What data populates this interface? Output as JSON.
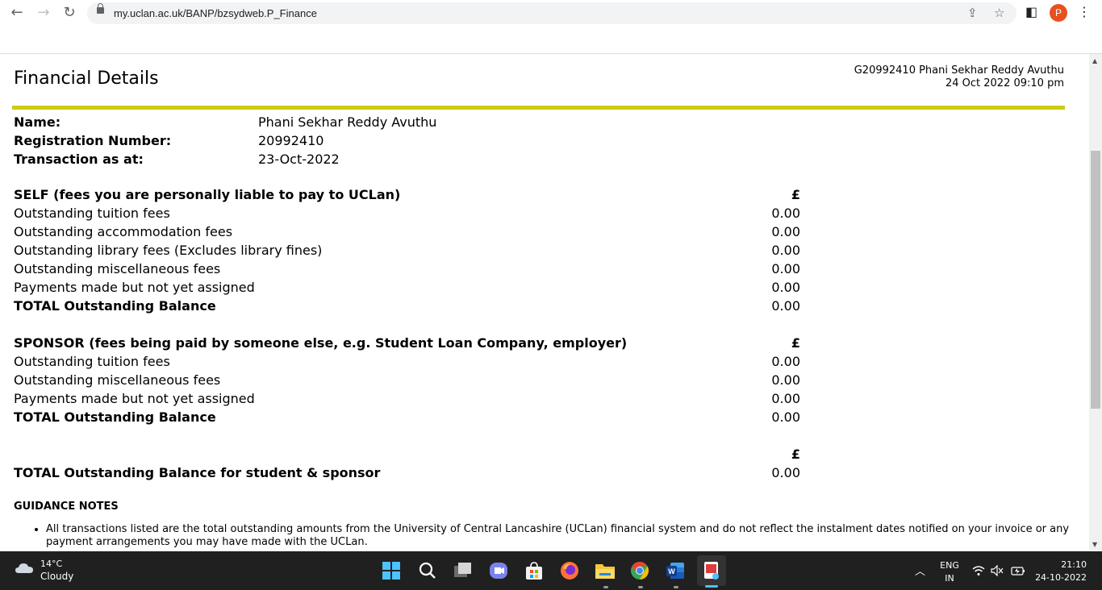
{
  "browser": {
    "url": "my.uclan.ac.uk/BANP/bzsydweb.P_Finance",
    "profile_initial": "P"
  },
  "header": {
    "title": "Financial Details",
    "user_line": "G20992410 Phani Sekhar Reddy Avuthu",
    "datetime_line": "24 Oct 2022 09:10 pm"
  },
  "student": {
    "name_label": "Name:",
    "name_value": "Phani Sekhar Reddy Avuthu",
    "reg_label": "Registration Number:",
    "reg_value": "20992410",
    "date_label": "Transaction as at:",
    "date_value": "23-Oct-2022"
  },
  "self": {
    "heading": "SELF (fees you are personally liable to pay to UCLan)",
    "currency": "£",
    "rows": [
      {
        "label": "Outstanding tuition fees",
        "amount": "0.00"
      },
      {
        "label": "Outstanding accommodation fees",
        "amount": "0.00"
      },
      {
        "label": "Outstanding library fees (Excludes library fines)",
        "amount": "0.00"
      },
      {
        "label": "Outstanding miscellaneous fees",
        "amount": "0.00"
      },
      {
        "label": "Payments made but not yet assigned",
        "amount": "0.00"
      }
    ],
    "total_label": "TOTAL Outstanding Balance",
    "total_amount": "0.00"
  },
  "sponsor": {
    "heading": "SPONSOR (fees being paid by someone else, e.g. Student Loan Company, employer)",
    "currency": "£",
    "rows": [
      {
        "label": "Outstanding tuition fees",
        "amount": "0.00"
      },
      {
        "label": "Outstanding miscellaneous fees",
        "amount": "0.00"
      },
      {
        "label": "Payments made but not yet assigned",
        "amount": "0.00"
      }
    ],
    "total_label": "TOTAL Outstanding Balance",
    "total_amount": "0.00"
  },
  "grand_total": {
    "currency": "£",
    "label": "TOTAL Outstanding Balance for student & sponsor",
    "amount": "0.00"
  },
  "guidance": {
    "title": "GUIDANCE NOTES",
    "notes": [
      "All transactions listed are the total outstanding amounts from the University of Central Lancashire (UCLan) financial system and do not reflect the instalment dates notified on your invoice or any payment arrangements you may have made with the UCLan."
    ]
  },
  "taskbar": {
    "temperature": "14°C",
    "weather": "Cloudy",
    "lang_top": "ENG",
    "lang_bottom": "IN",
    "time": "21:10",
    "date": "24-10-2022"
  },
  "colors": {
    "rule": "#cccc14",
    "profile": "#e8501f",
    "taskbar": "#202020"
  }
}
